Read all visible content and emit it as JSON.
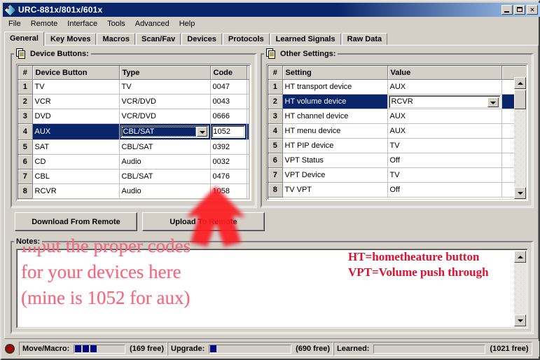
{
  "window": {
    "title": "URC-881x/801x/601x",
    "icon": "remote-control-icon",
    "minimize": "_",
    "maximize": "□",
    "close": "✕"
  },
  "menu": {
    "items": [
      "File",
      "Remote",
      "Interface",
      "Tools",
      "Advanced",
      "Help"
    ]
  },
  "tabs": {
    "items": [
      "General",
      "Key Moves",
      "Macros",
      "Scan/Fav",
      "Devices",
      "Protocols",
      "Learned Signals",
      "Raw Data"
    ],
    "active": "General"
  },
  "device_buttons": {
    "group_label": "Device Buttons:",
    "columns": [
      "#",
      "Device Button",
      "Type",
      "Code"
    ],
    "rows": [
      {
        "n": "1",
        "button": "TV",
        "type": "TV",
        "code": "0047",
        "selected": false
      },
      {
        "n": "2",
        "button": "VCR",
        "type": "VCR/DVD",
        "code": "0043",
        "selected": false
      },
      {
        "n": "3",
        "button": "DVD",
        "type": "VCR/DVD",
        "code": "0666",
        "selected": false
      },
      {
        "n": "4",
        "button": "AUX",
        "type": "CBL/SAT",
        "code": "1052",
        "selected": true
      },
      {
        "n": "5",
        "button": "SAT",
        "type": "CBL/SAT",
        "code": "0392",
        "selected": false
      },
      {
        "n": "6",
        "button": "CD",
        "type": "Audio",
        "code": "0032",
        "selected": false
      },
      {
        "n": "7",
        "button": "CBL",
        "type": "CBL/SAT",
        "code": "0476",
        "selected": false
      },
      {
        "n": "8",
        "button": "RCVR",
        "type": "Audio",
        "code": "1058",
        "selected": false
      }
    ]
  },
  "other_settings": {
    "group_label": "Other Settings:",
    "columns": [
      "#",
      "Setting",
      "Value"
    ],
    "rows": [
      {
        "n": "1",
        "setting": "HT transport device",
        "value": "AUX",
        "selected": false
      },
      {
        "n": "2",
        "setting": "HT volume device",
        "value": "RCVR",
        "selected": true
      },
      {
        "n": "3",
        "setting": "HT channel device",
        "value": "AUX",
        "selected": false
      },
      {
        "n": "4",
        "setting": "HT menu device",
        "value": "AUX",
        "selected": false
      },
      {
        "n": "5",
        "setting": "HT PIP device",
        "value": "TV",
        "selected": false
      },
      {
        "n": "6",
        "setting": "VPT Status",
        "value": "Off",
        "selected": false
      },
      {
        "n": "7",
        "setting": "VPT Device",
        "value": "TV",
        "selected": false
      },
      {
        "n": "8",
        "setting": "TV VPT",
        "value": "Off",
        "selected": false
      }
    ]
  },
  "actions": {
    "download": "Download From Remote",
    "upload": "Upload To Remote"
  },
  "notes": {
    "group_label": "Notes:",
    "value": ""
  },
  "annotations": {
    "left_lines": [
      "Input the proper codes",
      "for your devices here",
      "(mine is 1052 for aux)"
    ],
    "right_lines": [
      "HT=hometheature button",
      "VPT=Volume push through"
    ],
    "arrow": "red-arrow-up",
    "left_color": "#f06a80",
    "right_color": "#e01030",
    "arrow_color": "#ee1122"
  },
  "statusbar": {
    "move_macro_label": "Move/Macro:",
    "move_macro_blocks": 3,
    "move_macro_free": "(169 free)",
    "upgrade_label": "Upgrade:",
    "upgrade_blocks": 1,
    "upgrade_free": "(690 free)",
    "learned_label": "Learned:",
    "learned_blocks": 0,
    "learned_free": "(1021 free)"
  },
  "colors": {
    "selection": "#0a246a",
    "face": "#d4d0c8",
    "title_start": "#0a246a",
    "title_end": "#a6caf0"
  }
}
